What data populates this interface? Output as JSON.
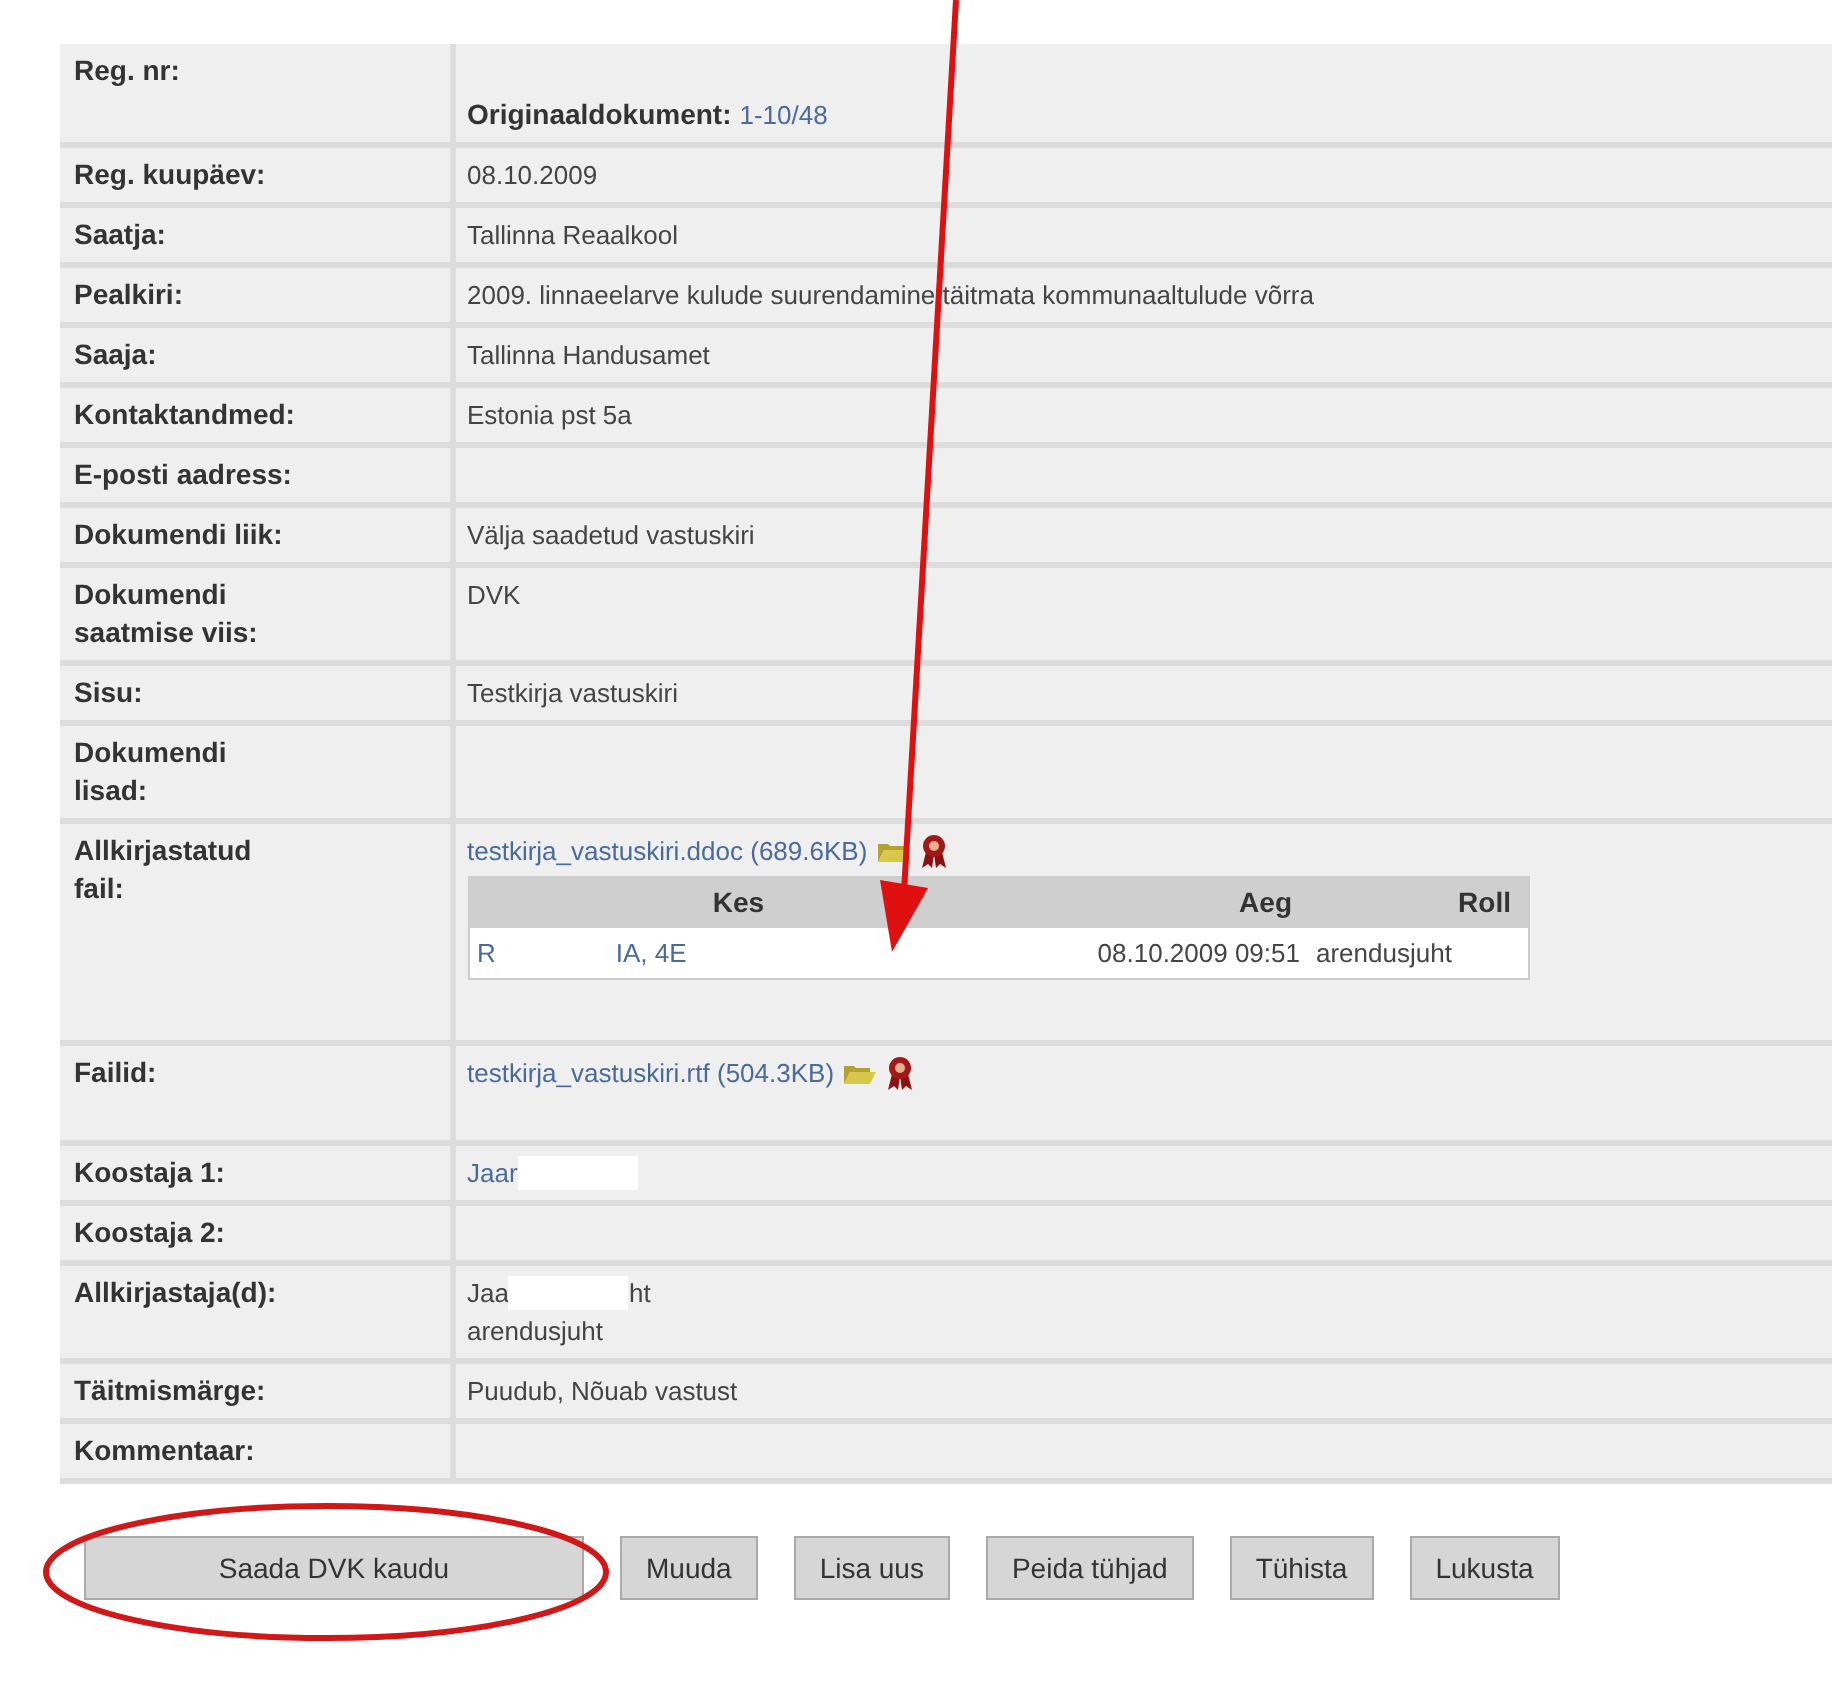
{
  "rows": [
    {
      "label": "Reg. nr:",
      "value": {
        "kind": "original",
        "caption": "Originaaldokument:",
        "link": "1-10/48"
      }
    },
    {
      "label": "Reg. kuupäev:",
      "value": {
        "kind": "text",
        "text": "08.10.2009"
      }
    },
    {
      "label": "Saatja:",
      "value": {
        "kind": "text",
        "text": "Tallinna Reaalkool"
      }
    },
    {
      "label": "Pealkiri:",
      "value": {
        "kind": "text",
        "text": "2009. linnaeelarve kulude suurendamine täitmata kommunaaltulude võrra"
      }
    },
    {
      "label": "Saaja:",
      "value": {
        "kind": "text",
        "text": "Tallinna Handusamet"
      }
    },
    {
      "label": "Kontaktandmed:",
      "value": {
        "kind": "text",
        "text": "Estonia pst 5a"
      }
    },
    {
      "label": "E-posti aadress:",
      "value": {
        "kind": "empty"
      }
    },
    {
      "label": "Dokumendi liik:",
      "value": {
        "kind": "text",
        "text": "Välja saadetud vastuskiri"
      }
    },
    {
      "label": "Dokumendi saatmise viis:",
      "value": {
        "kind": "text",
        "text": "DVK"
      }
    },
    {
      "label": "Sisu:",
      "value": {
        "kind": "text",
        "text": "Testkirja vastuskiri"
      }
    },
    {
      "label": "Dokumendi lisad:",
      "value": {
        "kind": "tall"
      }
    },
    {
      "label": "Allkirjastatud fail:",
      "value": {
        "kind": "signed_file",
        "file": "testkirja_vastuskiri.ddoc",
        "size": "(689.6KB)",
        "signers": {
          "columns": [
            "Kes",
            "Aeg",
            "Roll"
          ],
          "rows": [
            {
              "kes_parts": [
                "R",
                "IA, 4E"
              ],
              "aeg": "08.10.2009 09:51",
              "roll": "arendusjuht"
            }
          ]
        }
      }
    },
    {
      "label": "Failid:",
      "value": {
        "kind": "file",
        "file": "testkirja_vastuskiri.rtf",
        "size": "(504.3KB)"
      }
    },
    {
      "label": "Koostaja 1:",
      "value": {
        "kind": "redacted_link",
        "parts": [
          "Jaar"
        ]
      }
    },
    {
      "label": "Koostaja 2:",
      "value": {
        "kind": "empty"
      }
    },
    {
      "label": "Allkirjastaja(d):",
      "value": {
        "kind": "redacted_lines",
        "parts": [
          "Jaa",
          "ht"
        ],
        "second_line": "arendusjuht"
      }
    },
    {
      "label": "Täitmismärge:",
      "value": {
        "kind": "text",
        "text": "Puudub, Nõuab vastust"
      }
    },
    {
      "label": "Kommentaar:",
      "value": {
        "kind": "empty"
      }
    }
  ],
  "buttons": [
    {
      "label": "Saada DVK kaudu",
      "circled": true
    },
    {
      "label": "Muuda",
      "circled": false
    },
    {
      "label": "Lisa uus",
      "circled": false
    },
    {
      "label": "Peida tühjad",
      "circled": false
    },
    {
      "label": "Tühista",
      "circled": false
    },
    {
      "label": "Lukusta",
      "circled": false
    }
  ],
  "annotation_arrow": true
}
